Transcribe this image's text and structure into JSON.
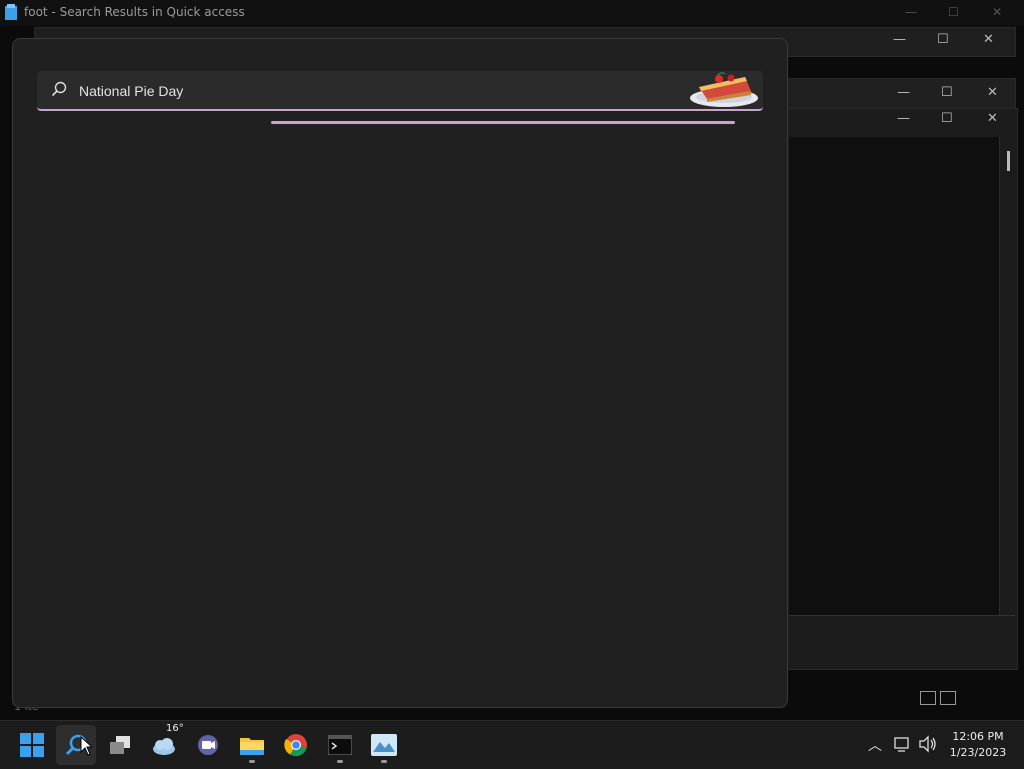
{
  "background_window": {
    "title": "foot - Search Results in Quick access",
    "status": "1 ite"
  },
  "search": {
    "query": "National Pie Day"
  },
  "taskbar": {
    "weather_temp": "16°",
    "time": "12:06 PM",
    "date": "1/23/2023"
  },
  "icons": [
    "folder-icon",
    "search-icon",
    "pie-image",
    "start-icon",
    "search-app-icon",
    "task-view-icon",
    "weather-icon",
    "teams-icon",
    "file-explorer-icon",
    "chrome-icon",
    "terminal-icon",
    "photos-icon",
    "chevron-up-icon",
    "network-icon",
    "volume-icon"
  ],
  "colors": {
    "accent": "#c9a3d3",
    "panel": "#202020",
    "taskbar": "#1c1c1c"
  }
}
